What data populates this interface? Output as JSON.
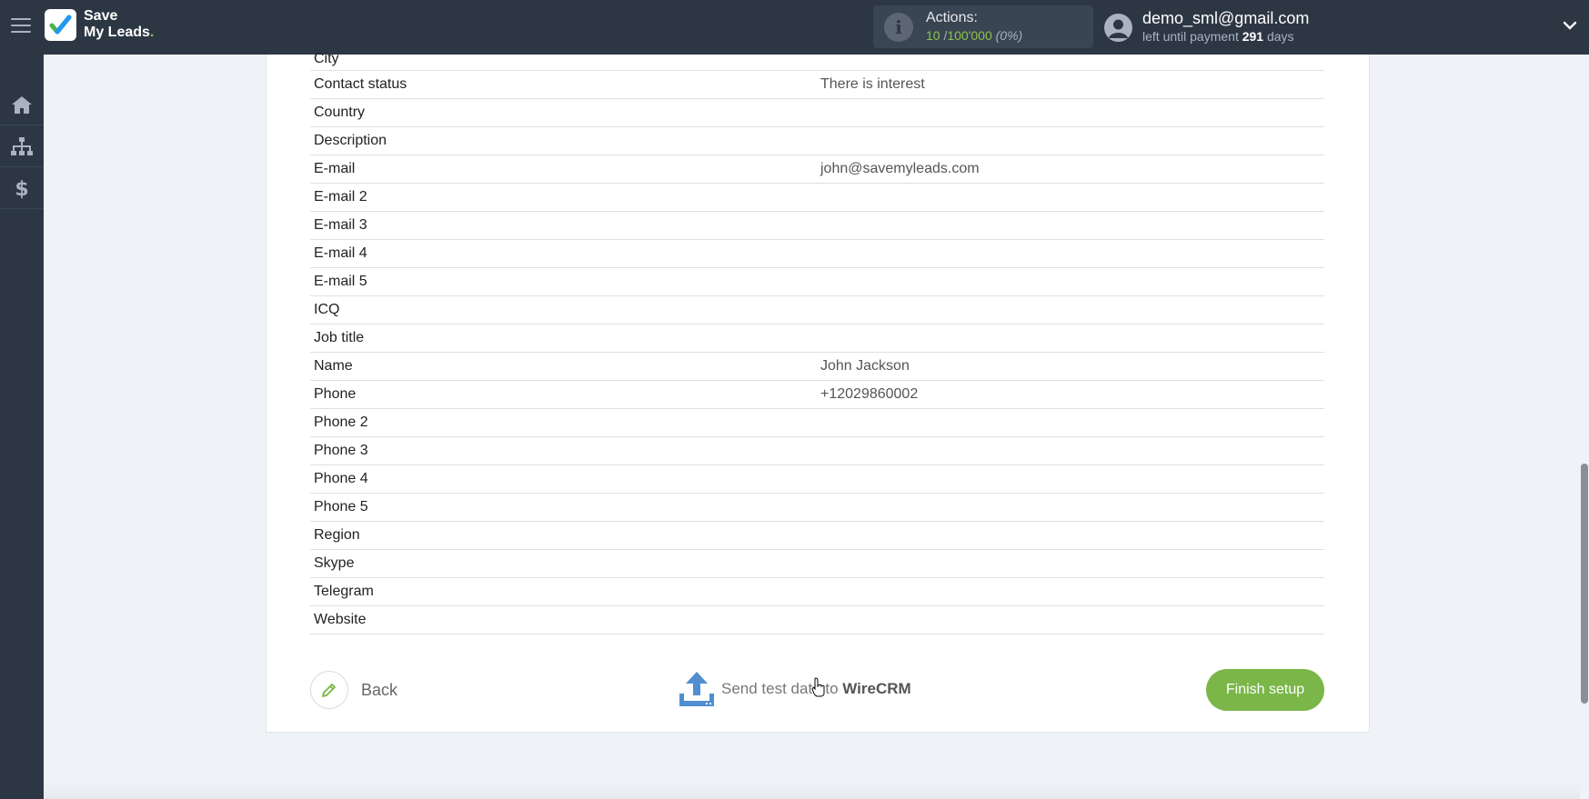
{
  "header": {
    "logo_line1": "Save",
    "logo_line2": "My Leads",
    "logo_dot": ".",
    "actions_label": "Actions:",
    "actions_used": "10",
    "actions_separator": " /",
    "actions_limit": "100'000",
    "actions_percent": "(0%)",
    "user_email": "demo_sml@gmail.com",
    "payment_prefix": "left until payment ",
    "payment_days": "291",
    "payment_suffix": " days"
  },
  "sidebar": {
    "items": [
      {
        "icon": "home-icon"
      },
      {
        "icon": "sitemap-icon"
      },
      {
        "icon": "dollar-icon"
      }
    ]
  },
  "fields": [
    {
      "name": "City",
      "value": ""
    },
    {
      "name": "Contact status",
      "value": "There is interest"
    },
    {
      "name": "Country",
      "value": ""
    },
    {
      "name": "Description",
      "value": ""
    },
    {
      "name": "E-mail",
      "value": "john@savemyleads.com"
    },
    {
      "name": "E-mail 2",
      "value": ""
    },
    {
      "name": "E-mail 3",
      "value": ""
    },
    {
      "name": "E-mail 4",
      "value": ""
    },
    {
      "name": "E-mail 5",
      "value": ""
    },
    {
      "name": "ICQ",
      "value": ""
    },
    {
      "name": "Job title",
      "value": ""
    },
    {
      "name": "Name",
      "value": "John Jackson"
    },
    {
      "name": "Phone",
      "value": "+12029860002"
    },
    {
      "name": "Phone 2",
      "value": ""
    },
    {
      "name": "Phone 3",
      "value": ""
    },
    {
      "name": "Phone 4",
      "value": ""
    },
    {
      "name": "Phone 5",
      "value": ""
    },
    {
      "name": "Region",
      "value": ""
    },
    {
      "name": "Skype",
      "value": ""
    },
    {
      "name": "Telegram",
      "value": ""
    },
    {
      "name": "Website",
      "value": ""
    }
  ],
  "actions": {
    "back_label": "Back",
    "send_test_prefix": "Send test data to ",
    "send_test_target": "WireCRM",
    "finish_label": "Finish setup"
  },
  "colors": {
    "topbar": "#2d3744",
    "accent_green": "#7ab648",
    "send_icon_blue": "#4f8fd0"
  }
}
